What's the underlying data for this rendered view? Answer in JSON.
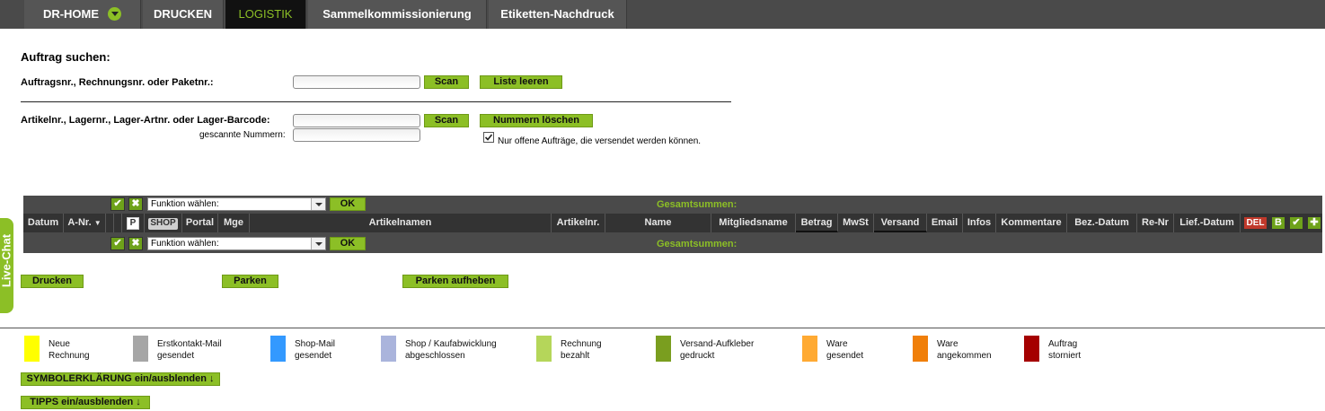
{
  "nav": {
    "tabs": [
      "DR-HOME",
      "DRUCKEN",
      "LOGISTIK",
      "Sammelkommissionierung",
      "Etiketten-Nachdruck"
    ],
    "active": "LOGISTIK"
  },
  "search": {
    "heading": "Auftrag suchen:",
    "order_label": "Auftragsnr., Rechnungsnr. oder Paketnr.:",
    "scan_label": "Scan",
    "clear_list_label": "Liste leeren",
    "article_label": "Artikelnr., Lagernr., Lager-Artnr. oder Lager-Barcode:",
    "clear_numbers_label": "Nummern löschen",
    "scanned_label": "gescannte Nummern:",
    "open_orders_label": "Nur offene Aufträge, die versendet werden können."
  },
  "table": {
    "function_select": "Funktion wählen:",
    "ok_label": "OK",
    "totals_label": "Gesamtsummen:",
    "columns": [
      "Datum",
      "A-Nr.",
      "Portal",
      "Mge",
      "Artikelnamen",
      "Artikelnr.",
      "Name",
      "Mitgliedsname",
      "Betrag",
      "MwSt",
      "Versand",
      "Email",
      "Infos",
      "Kommentare",
      "Bez.-Datum",
      "Re-Nr",
      "Lief.-Datum"
    ],
    "badge_p": "P",
    "badge_shop": "SHOP",
    "badge_del": "DEL",
    "badge_b": "B"
  },
  "actions": {
    "print_label": "Drucken",
    "park_label": "Parken",
    "unpark_label": "Parken aufheben"
  },
  "legend": [
    {
      "line1": "Neue",
      "line2": "Rechnung",
      "color": "#ffff00"
    },
    {
      "line1": "Erstkontakt-Mail",
      "line2": "gesendet",
      "color": "#a6a6a6"
    },
    {
      "line1": "Shop-Mail",
      "line2": "gesendet",
      "color": "#3399ff"
    },
    {
      "line1": "Shop / Kaufabwicklung",
      "line2": "abgeschlossen",
      "color": "#aab4dc"
    },
    {
      "line1": "Rechnung",
      "line2": "bezahlt",
      "color": "#b5d65a"
    },
    {
      "line1": "Versand-Aufkleber",
      "line2": "gedruckt",
      "color": "#7a9e1f"
    },
    {
      "line1": "Ware",
      "line2": "gesendet",
      "color": "#ffaa33"
    },
    {
      "line1": "Ware",
      "line2": "angekommen",
      "color": "#f07f0a"
    },
    {
      "line1": "Auftrag",
      "line2": "storniert",
      "color": "#a50000"
    }
  ],
  "toggles": {
    "symbols_label": "SYMBOLERKLÄRUNG ein/ausblenden ↓",
    "tips_label": "TIPPS ein/ausblenden ↓"
  },
  "livechat": {
    "label": "Live-Chat"
  }
}
